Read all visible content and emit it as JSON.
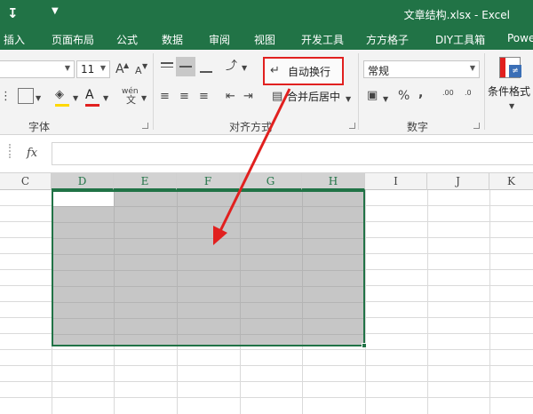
{
  "window": {
    "title": "文章结构.xlsx - Excel"
  },
  "tabs": [
    "插入",
    "页面布局",
    "公式",
    "数据",
    "审阅",
    "视图",
    "开发工具",
    "方方格子",
    "DIY工具箱",
    "Powe"
  ],
  "font_group": {
    "font_size": "11",
    "grow_label": "A",
    "shrink_label": "A",
    "font_color_label": "A",
    "wen_label": "wén",
    "wen_char": "文",
    "group_label": "字体"
  },
  "alignment_group": {
    "wrap_text_label": "自动换行",
    "merge_center_label": "合并后居中",
    "group_label": "对齐方式"
  },
  "number_group": {
    "format_value": "常规",
    "percent_label": "%",
    "comma_label": ",",
    "inc_decimal": ".00",
    "dec_decimal": ".0",
    "group_label": "数字"
  },
  "styles_group": {
    "conditional_label": "条件格式"
  },
  "formula_bar": {
    "fx_label": "fx"
  },
  "columns": [
    "C",
    "D",
    "E",
    "F",
    "G",
    "H",
    "I",
    "J",
    "K"
  ],
  "colors": {
    "excel_green": "#217346",
    "selection_gray": "#c6c6c6",
    "highlight_red": "#e1201f"
  }
}
